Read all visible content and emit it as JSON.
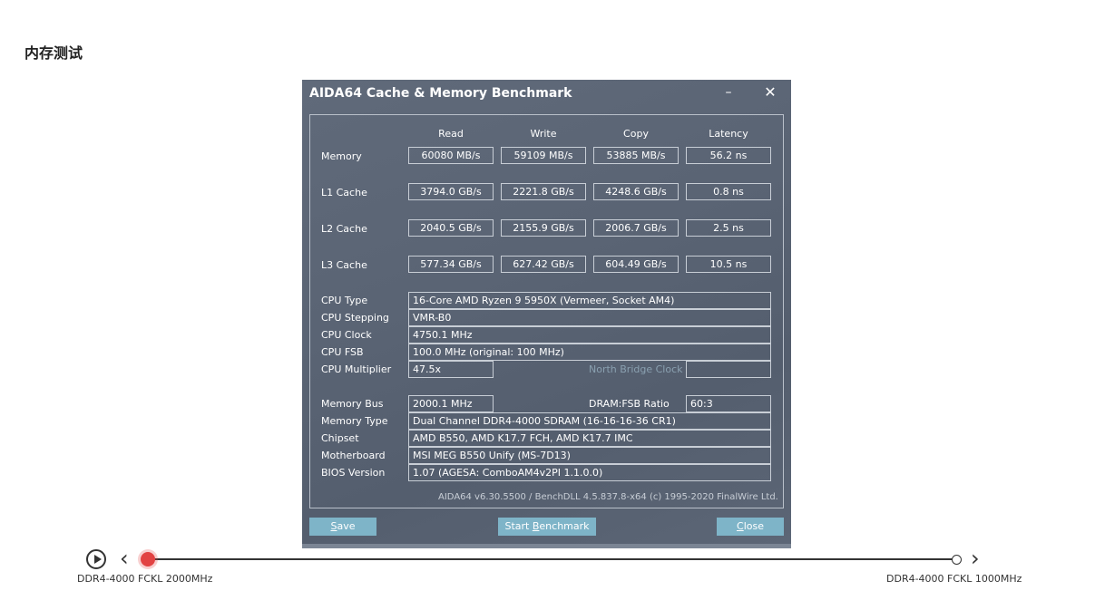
{
  "page": {
    "title": "内存测试"
  },
  "window": {
    "title": "AIDA64 Cache & Memory Benchmark",
    "minimize_label": "–",
    "close_label": "✕",
    "columns": [
      "Read",
      "Write",
      "Copy",
      "Latency"
    ],
    "results": [
      {
        "label": "Memory",
        "values": [
          "60080 MB/s",
          "59109 MB/s",
          "53885 MB/s",
          "56.2 ns"
        ]
      },
      {
        "label": "L1 Cache",
        "values": [
          "3794.0 GB/s",
          "2221.8 GB/s",
          "4248.6 GB/s",
          "0.8 ns"
        ]
      },
      {
        "label": "L2 Cache",
        "values": [
          "2040.5 GB/s",
          "2155.9 GB/s",
          "2006.7 GB/s",
          "2.5 ns"
        ]
      },
      {
        "label": "L3 Cache",
        "values": [
          "577.34 GB/s",
          "627.42 GB/s",
          "604.49 GB/s",
          "10.5 ns"
        ]
      }
    ],
    "cpu": {
      "type_label": "CPU Type",
      "type_value": "16-Core AMD Ryzen 9 5950X  (Vermeer, Socket AM4)",
      "stepping_label": "CPU Stepping",
      "stepping_value": "VMR-B0",
      "clock_label": "CPU Clock",
      "clock_value": "4750.1 MHz",
      "fsb_label": "CPU FSB",
      "fsb_value": "100.0 MHz  (original: 100 MHz)",
      "multiplier_label": "CPU Multiplier",
      "multiplier_value": "47.5x",
      "nb_clock_label": "North Bridge Clock",
      "nb_clock_value": ""
    },
    "memory": {
      "bus_label": "Memory Bus",
      "bus_value": "2000.1 MHz",
      "ratio_label": "DRAM:FSB Ratio",
      "ratio_value": "60:3",
      "type_label": "Memory Type",
      "type_value": "Dual Channel DDR4-4000 SDRAM  (16-16-16-36 CR1)",
      "chipset_label": "Chipset",
      "chipset_value": "AMD B550, AMD K17.7 FCH, AMD K17.7 IMC",
      "motherboard_label": "Motherboard",
      "motherboard_value": "MSI MEG B550 Unify (MS-7D13)",
      "bios_label": "BIOS Version",
      "bios_value": "1.07  (AGESA: ComboAM4v2PI 1.1.0.0)"
    },
    "footer": "AIDA64 v6.30.5500 / BenchDLL 4.5.837.8-x64  (c) 1995-2020 FinalWire Ltd.",
    "buttons": {
      "save_ul": "S",
      "save_rest": "ave",
      "start_pre": "Start ",
      "start_ul": "B",
      "start_rest": "enchmark",
      "close_ul": "C",
      "close_rest": "lose"
    }
  },
  "slider": {
    "prev_icon": "‹",
    "next_icon": "›",
    "start_label": "DDR4-4000 FCKL 2000MHz",
    "end_label": "DDR4-4000 FCKL 1000MHz",
    "position": 0,
    "accent": "#e24343"
  }
}
